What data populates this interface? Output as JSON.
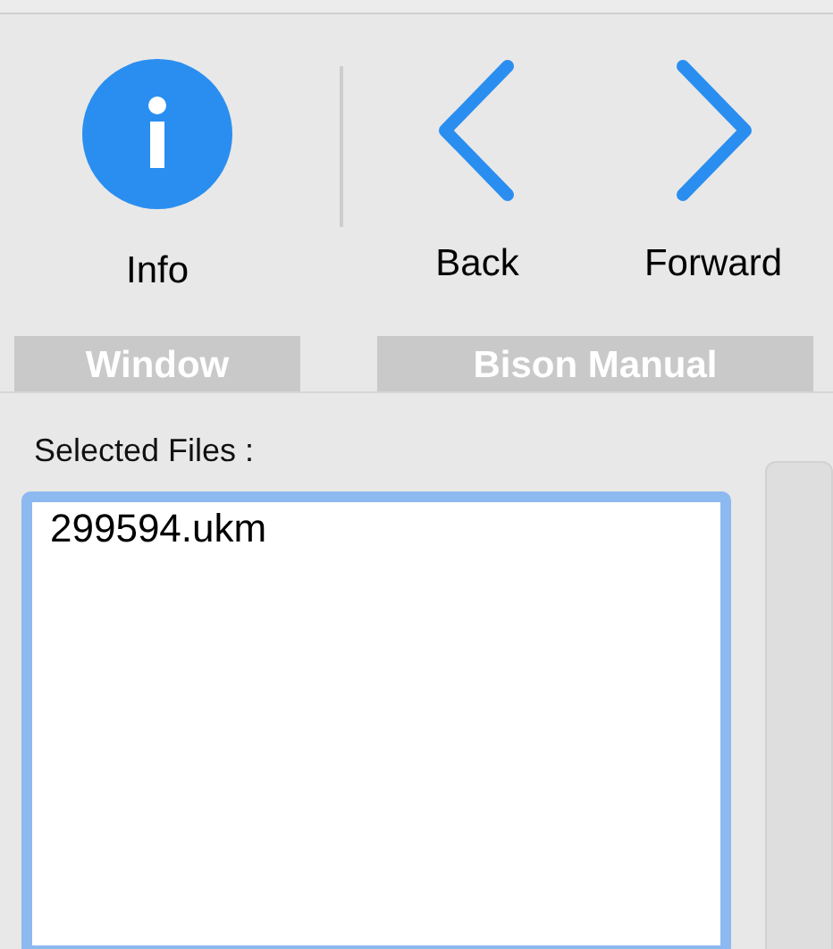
{
  "toolbar": {
    "groups": [
      {
        "label": "Window",
        "items": [
          {
            "kind": "info",
            "label": "Info"
          }
        ]
      },
      {
        "label": "Bison Manual",
        "items": [
          {
            "kind": "back",
            "label": "Back"
          },
          {
            "kind": "forward",
            "label": "Forward"
          }
        ]
      }
    ]
  },
  "selected_files": {
    "label": "Selected Files :",
    "files": [
      "299594.ukm"
    ]
  }
}
